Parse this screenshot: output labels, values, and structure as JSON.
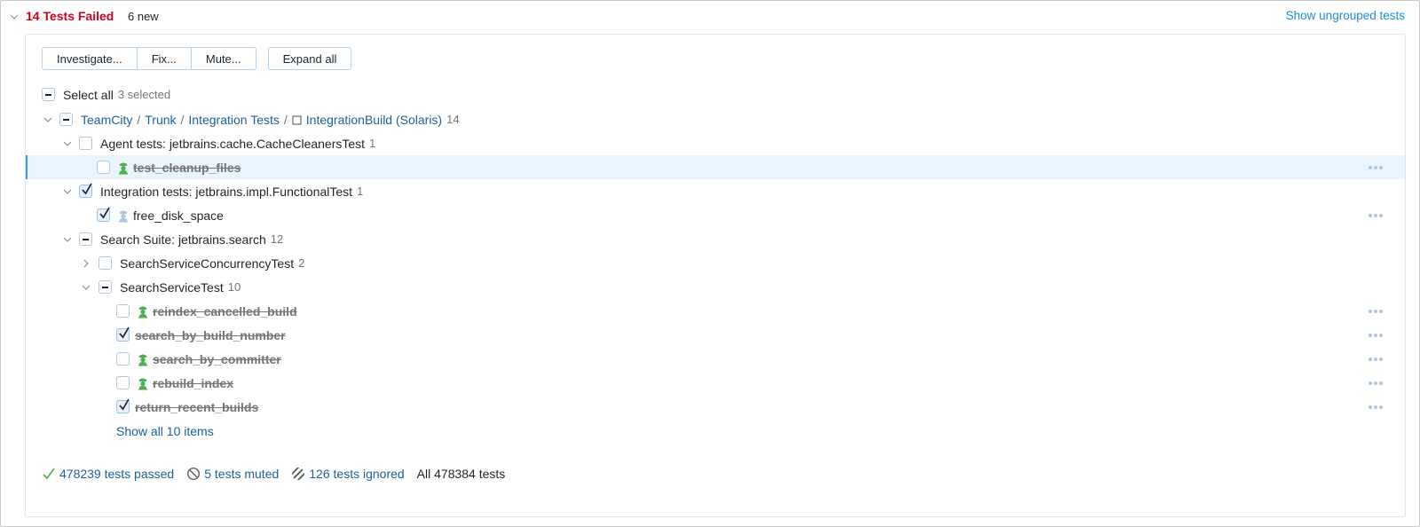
{
  "header": {
    "title": "14 Tests Failed",
    "new_count": "6 new",
    "ungrouped_link": "Show ungrouped tests"
  },
  "toolbar": {
    "investigate": "Investigate...",
    "fix": "Fix...",
    "mute": "Mute...",
    "expand_all": "Expand all"
  },
  "select_all": {
    "label": "Select all",
    "selected": "3 selected",
    "state": "indeterminate"
  },
  "breadcrumb": {
    "items": [
      "TeamCity",
      "Trunk",
      "Integration Tests",
      "IntegrationBuild (Solaris)"
    ],
    "separator": "/",
    "count": "14",
    "state": "indeterminate"
  },
  "tree": {
    "agent_suite": {
      "label": "Agent tests: jetbrains.cache.CacheCleanersTest",
      "count": "1",
      "state": "unchecked"
    },
    "test_cleanup_files": {
      "label": "test_cleanup_files",
      "state": "unchecked",
      "investigator": "green",
      "muted": true
    },
    "integration_suite": {
      "label": "Integration tests: jetbrains.impl.FunctionalTest",
      "count": "1",
      "state": "checked"
    },
    "free_disk_space": {
      "label": "free_disk_space",
      "state": "checked",
      "investigator": "blue",
      "muted": false
    },
    "search_suite": {
      "label": "Search Suite: jetbrains.search",
      "count": "12",
      "state": "indeterminate"
    },
    "concurrency_test": {
      "label": "SearchServiceConcurrencyTest",
      "count": "2",
      "state": "unchecked",
      "expanded": false
    },
    "service_test": {
      "label": "SearchServiceTest",
      "count": "10",
      "state": "indeterminate",
      "expanded": true
    },
    "tests": [
      {
        "label": "reindex_cancelled_build",
        "state": "unchecked",
        "investigator": "green"
      },
      {
        "label": "search_by_build_number",
        "state": "checked",
        "investigator": "none"
      },
      {
        "label": "search_by_committer",
        "state": "unchecked",
        "investigator": "green"
      },
      {
        "label": "rebuild_index",
        "state": "unchecked",
        "investigator": "green"
      },
      {
        "label": "return_recent_builds",
        "state": "checked",
        "investigator": "none"
      }
    ],
    "show_all": "Show all 10 items"
  },
  "footer": {
    "passed": "478239 tests passed",
    "muted": "5 tests muted",
    "ignored": "126 tests ignored",
    "all": "All 478384 tests"
  },
  "colors": {
    "failed": "#d0021b",
    "link": "#1c5f9a",
    "link_header": "#1a8ee0",
    "investigator_green": "#4caf50",
    "investigator_blue": "#a9c7e3",
    "selected_row": "#eaf4fd",
    "passed": "#4caf50"
  }
}
